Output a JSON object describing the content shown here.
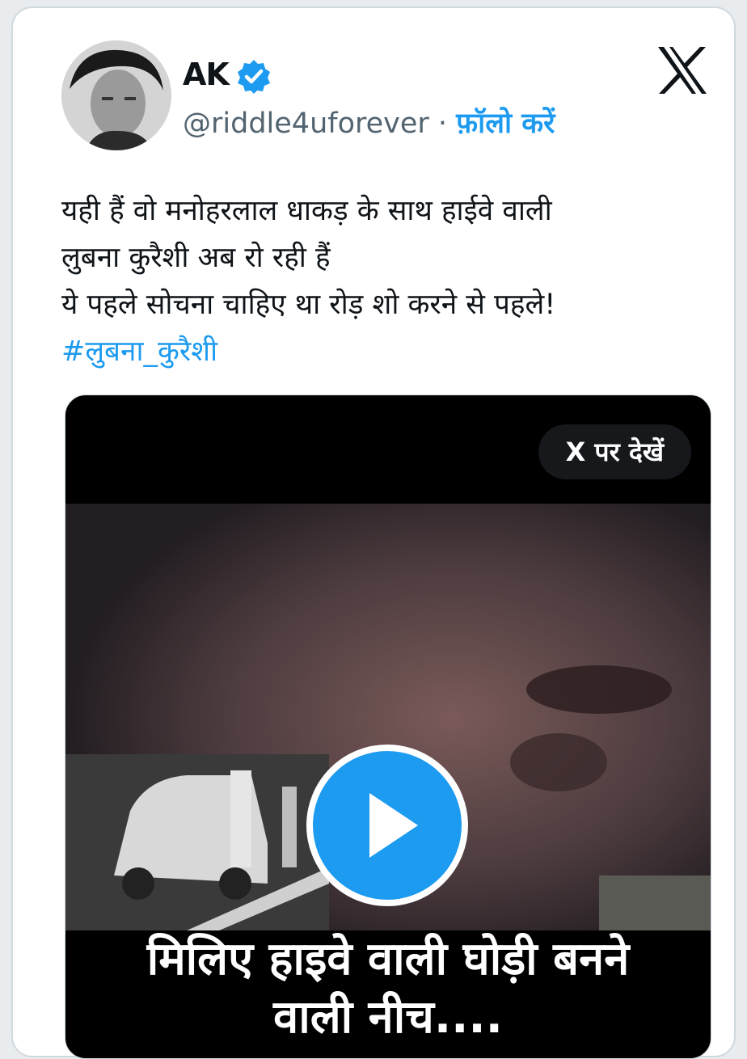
{
  "tweet": {
    "author_name": "AK",
    "handle": "@riddle4uforever",
    "separator": " · ",
    "follow_label": "फ़ॉलो करें",
    "lines": [
      "यही हैं वो मनोहरलाल धाकड़ के साथ हाईवे वाली",
      "लुबना कुरैशी अब रो रही हैं",
      "ये पहले सोचना चाहिए था रोड़ शो करने से पहले!"
    ],
    "hashtag": "#लुबना_कुरैशी"
  },
  "media": {
    "watch_label": "X पर देखें",
    "caption_line1": "मिलिए हाइवे वाली घोड़ी बनने",
    "caption_line2": "वाली नीच...."
  },
  "icons": {
    "verified": "verified-badge-icon",
    "brand": "x-logo-icon",
    "play": "play-icon"
  },
  "colors": {
    "accent": "#1d9bf0",
    "text": "#0f1419",
    "muted": "#536471"
  }
}
